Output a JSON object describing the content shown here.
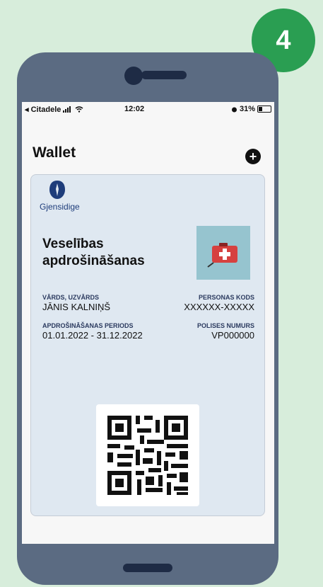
{
  "step_badge": "4",
  "status_bar": {
    "carrier": "◂ Citadele",
    "time": "12:02",
    "battery": "31%",
    "battery_level": 0.31
  },
  "wallet": {
    "title": "Wallet",
    "add_label": "+"
  },
  "card": {
    "brand": "Gjensidige",
    "title_line1": "Veselības",
    "title_line2": "apdrošināšanas",
    "name_label": "VĀRDS, UZVĀRDS",
    "name_value": "JĀNIS KALNIŅŠ",
    "id_label": "PERSONAS KODS",
    "id_value": "XXXXXX-XXXXX",
    "period_label": "APDROŠINĀŠANAS PERIODS",
    "period_value": "01.01.2022 - 31.12.2022",
    "policy_label": "POLISES NUMURS",
    "policy_value": "VP000000"
  },
  "colors": {
    "page_bg": "#d7eddb",
    "phone_frame": "#5b6b82",
    "badge": "#2a9e52",
    "card_bg": "#dfe8f1",
    "brand_blue": "#1e3d7b",
    "image_bg": "#96c4cf",
    "kit_red": "#d6413f"
  }
}
